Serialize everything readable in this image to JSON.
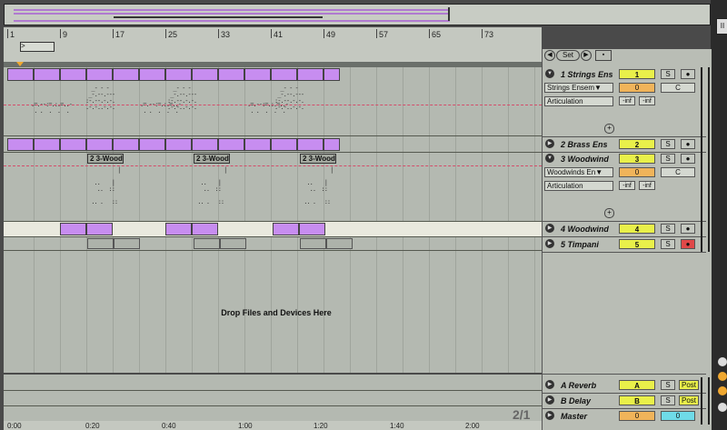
{
  "ruler": {
    "bars": [
      "1",
      "9",
      "17",
      "25",
      "33",
      "41",
      "49",
      "57",
      "65",
      "73"
    ],
    "loop_label": ">"
  },
  "overview": {
    "label": ""
  },
  "set_row": {
    "set_label": "Set"
  },
  "tracks": [
    {
      "name": "1 Strings Ens",
      "number": "1",
      "solo": "S",
      "arm": "●",
      "device": "Strings Ensem▼",
      "chooser": "Articulation",
      "volume": "0",
      "pan": "C",
      "inf1": "-inf",
      "inf2": "-inf"
    },
    {
      "name": "2 Brass Ens",
      "number": "2",
      "solo": "S",
      "arm": "●"
    },
    {
      "name": "3 Woodwind",
      "number": "3",
      "solo": "S",
      "arm": "●",
      "device": "Woodwinds En▼",
      "chooser": "Articulation",
      "volume": "0",
      "pan": "C",
      "inf1": "-inf",
      "inf2": "-inf"
    },
    {
      "name": "4 Woodwind",
      "number": "4",
      "solo": "S",
      "arm": "●"
    },
    {
      "name": "5 Timpani",
      "number": "5",
      "solo": "S",
      "arm": "●"
    }
  ],
  "returns": [
    {
      "name": "A Reverb",
      "number": "A",
      "solo": "S",
      "post": "Post"
    },
    {
      "name": "B Delay",
      "number": "B",
      "solo": "S",
      "post": "Post"
    }
  ],
  "master": {
    "name": "Master",
    "volume": "0",
    "pan": "0"
  },
  "clip_labels": {
    "woodwind": "2 3-Wood"
  },
  "drop_text": "Drop Files and Devices Here",
  "page_indicator": "2/1",
  "timeline": [
    "0:00",
    "0:20",
    "0:40",
    "1:00",
    "1:20",
    "1:40",
    "2:00"
  ],
  "colors": {
    "clip": "#c78df0",
    "track_number": "#e9f04a",
    "volume": "#f0b45a",
    "arm_active": "#e04848",
    "pan_master": "#6fdbe8"
  }
}
